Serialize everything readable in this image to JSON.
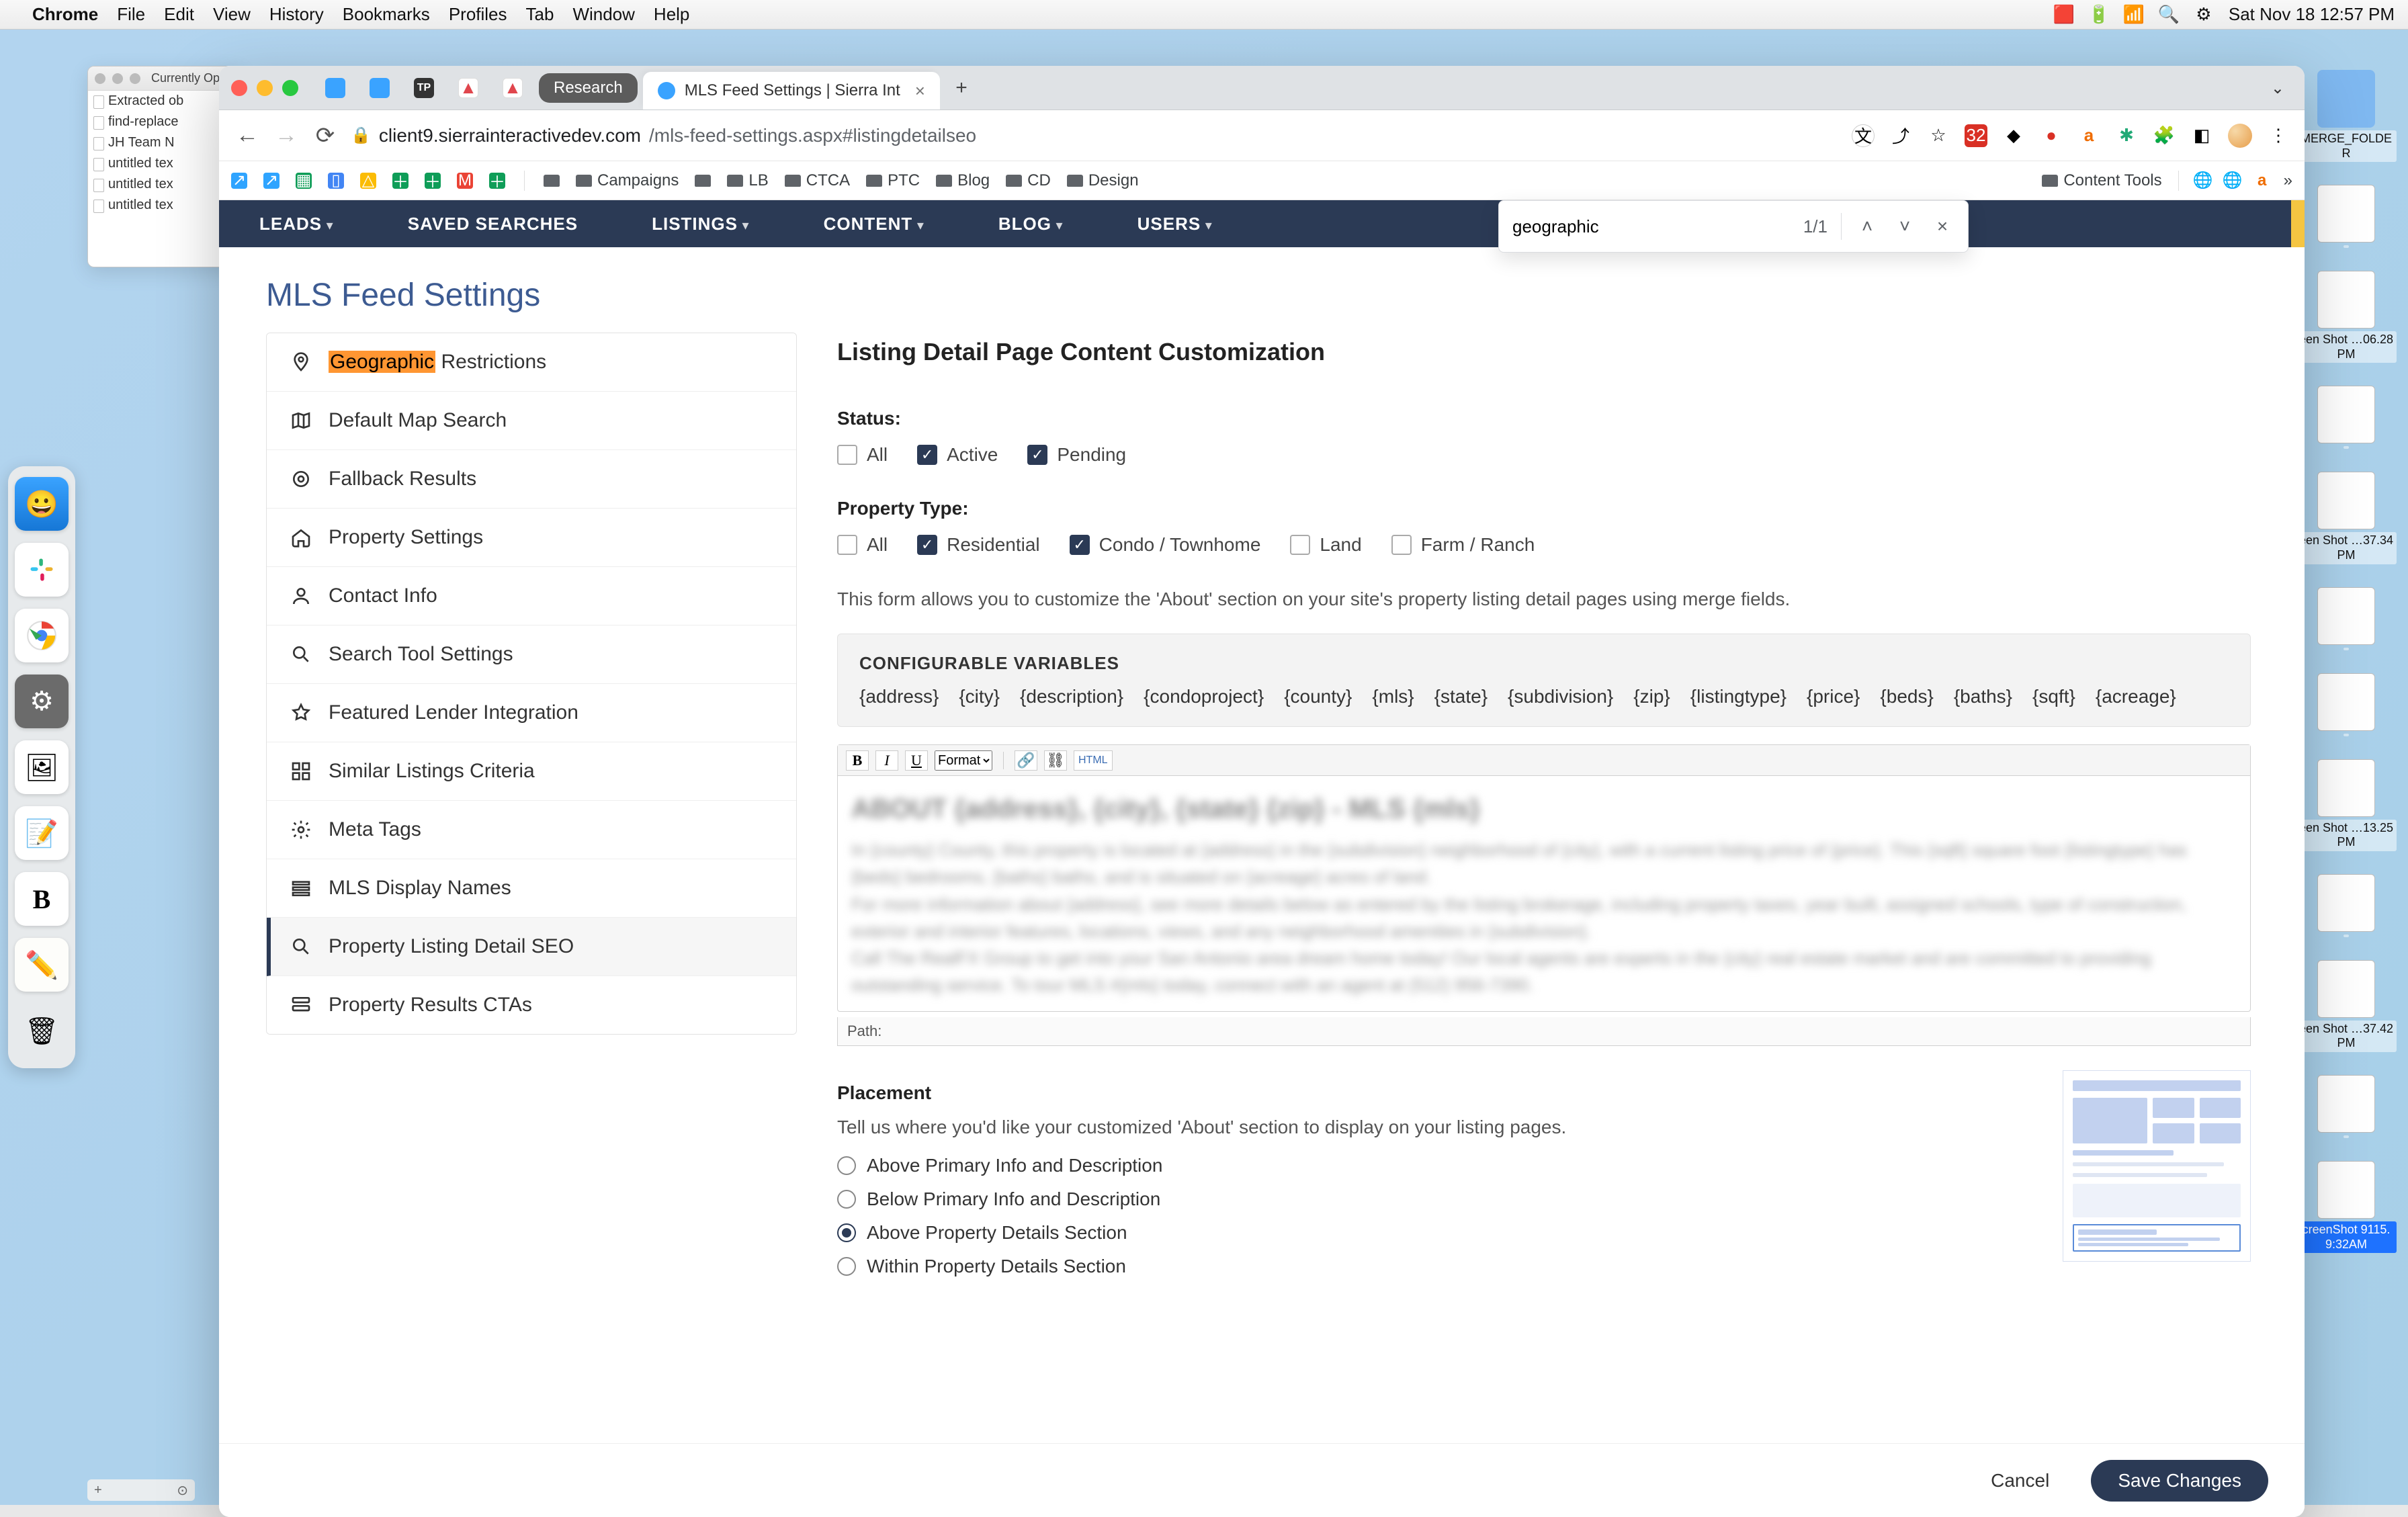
{
  "menubar": {
    "app": "Chrome",
    "items": [
      "File",
      "Edit",
      "View",
      "History",
      "Bookmarks",
      "Profiles",
      "Tab",
      "Window",
      "Help"
    ],
    "datetime": "Sat Nov 18  12:57 PM"
  },
  "bgwindow": {
    "title": "Currently Open",
    "files": [
      "Extracted ob",
      "find-replace",
      "JH Team N",
      "untitled tex",
      "untitled tex",
      "untitled tex"
    ]
  },
  "dock_bottom": {
    "left": "+",
    "right": "⊙"
  },
  "chrome": {
    "tabs": {
      "research": "Research",
      "active": "MLS Feed Settings | Sierra Int"
    },
    "url": {
      "host": "client9.sierrainteractivedev.com",
      "path": "/mls-feed-settings.aspx#listingdetailseo"
    },
    "extension_badge": "32",
    "bookmarks": {
      "left_icons": 9,
      "folders": [
        "Campaigns",
        "LB",
        "CTCA",
        "PTC",
        "Blog",
        "CD",
        "Design"
      ],
      "right_folder": "Content Tools",
      "overflow": "»"
    },
    "find": {
      "query": "geographic",
      "count": "1/1"
    }
  },
  "app": {
    "nav": [
      "LEADS",
      "SAVED SEARCHES",
      "LISTINGS",
      "CONTENT",
      "BLOG",
      "USERS"
    ],
    "title": "MLS Feed Settings",
    "sidenav": [
      {
        "icon": "pin",
        "label_pre": "Geographic",
        "label_post": " Restrictions",
        "highlighted": true
      },
      {
        "icon": "map",
        "label": "Default Map Search"
      },
      {
        "icon": "target",
        "label": "Fallback Results"
      },
      {
        "icon": "home",
        "label": "Property Settings"
      },
      {
        "icon": "user",
        "label": "Contact Info"
      },
      {
        "icon": "search",
        "label": "Search Tool Settings"
      },
      {
        "icon": "star",
        "label": "Featured Lender Integration"
      },
      {
        "icon": "grid",
        "label": "Similar Listings Criteria"
      },
      {
        "icon": "gear",
        "label": "Meta Tags"
      },
      {
        "icon": "list",
        "label": "MLS Display Names"
      },
      {
        "icon": "zoom",
        "label": "Property Listing Detail SEO",
        "active": true
      },
      {
        "icon": "rows",
        "label": "Property Results CTAs"
      }
    ],
    "section_title": "Listing Detail Page Content Customization",
    "status": {
      "label": "Status:",
      "options": [
        {
          "label": "All",
          "checked": false
        },
        {
          "label": "Active",
          "checked": true
        },
        {
          "label": "Pending",
          "checked": true
        }
      ]
    },
    "ptype": {
      "label": "Property Type:",
      "options": [
        {
          "label": "All",
          "checked": false
        },
        {
          "label": "Residential",
          "checked": true
        },
        {
          "label": "Condo / Townhome",
          "checked": true
        },
        {
          "label": "Land",
          "checked": false
        },
        {
          "label": "Farm / Ranch",
          "checked": false
        }
      ]
    },
    "helper": "This form allows you to customize the 'About' section on your site's property listing detail pages using merge fields.",
    "vars": {
      "title": "CONFIGURABLE VARIABLES",
      "list": [
        "{address}",
        "{city}",
        "{description}",
        "{condoproject}",
        "{county}",
        "{mls}",
        "{state}",
        "{subdivision}",
        "{zip}",
        "{listingtype}",
        "{price}",
        "{beds}",
        "{baths}",
        "{sqft}",
        "{acreage}"
      ]
    },
    "editor": {
      "format": "Format",
      "html": "HTML",
      "blurred_heading": "ABOUT {address}, {city}, {state} {zip} - MLS {mls}",
      "blurred_lines": [
        "In {county} County, this property is located at {address} in the {subdivision} neighborhood of {city}, with a current listing price of {price}. This {sqft} square foot {listingtype} has {beds} bedrooms, {baths} baths, and is situated on {acreage} acres of land.",
        "For more information about {address}, see more details below as entered by the listing brokerage, including property taxes, year built, assigned schools, type of construction, exterior and interior features, locations, views, and any neighborhood amenities in {subdivision}.",
        "Call The RealFX Group to get into your San Antonio area dream home today! Our local agents are experts in the {city} real estate market and are committed to providing outstanding service. To tour MLS #{mls} today, connect with an agent at (512) 956-7390."
      ],
      "path": "Path:"
    },
    "placement": {
      "label": "Placement",
      "helper": "Tell us where you'd like your customized 'About' section to display on your listing pages.",
      "options": [
        "Above Primary Info and Description",
        "Below Primary Info and Description",
        "Above Property Details Section",
        "Within Property Details Section"
      ],
      "selected_index": 2
    },
    "footer": {
      "cancel": "Cancel",
      "save": "Save Changes"
    }
  },
  "desktop_icons": [
    {
      "type": "folder",
      "label": "MERGE_FOLDER"
    },
    {
      "type": "file",
      "label": ""
    },
    {
      "type": "file",
      "label": "een Shot …06.28 PM"
    },
    {
      "type": "file",
      "label": ""
    },
    {
      "type": "file",
      "label": "een Shot …37.34 PM"
    },
    {
      "type": "file",
      "label": ""
    },
    {
      "type": "file",
      "label": ""
    },
    {
      "type": "file",
      "label": "een Shot …13.25 PM"
    },
    {
      "type": "file",
      "label": ""
    },
    {
      "type": "file",
      "label": "een Shot …37.42 PM"
    },
    {
      "type": "file",
      "label": ""
    },
    {
      "type": "file",
      "label": "creenShot 9115.9:32AM",
      "selected": true
    }
  ]
}
